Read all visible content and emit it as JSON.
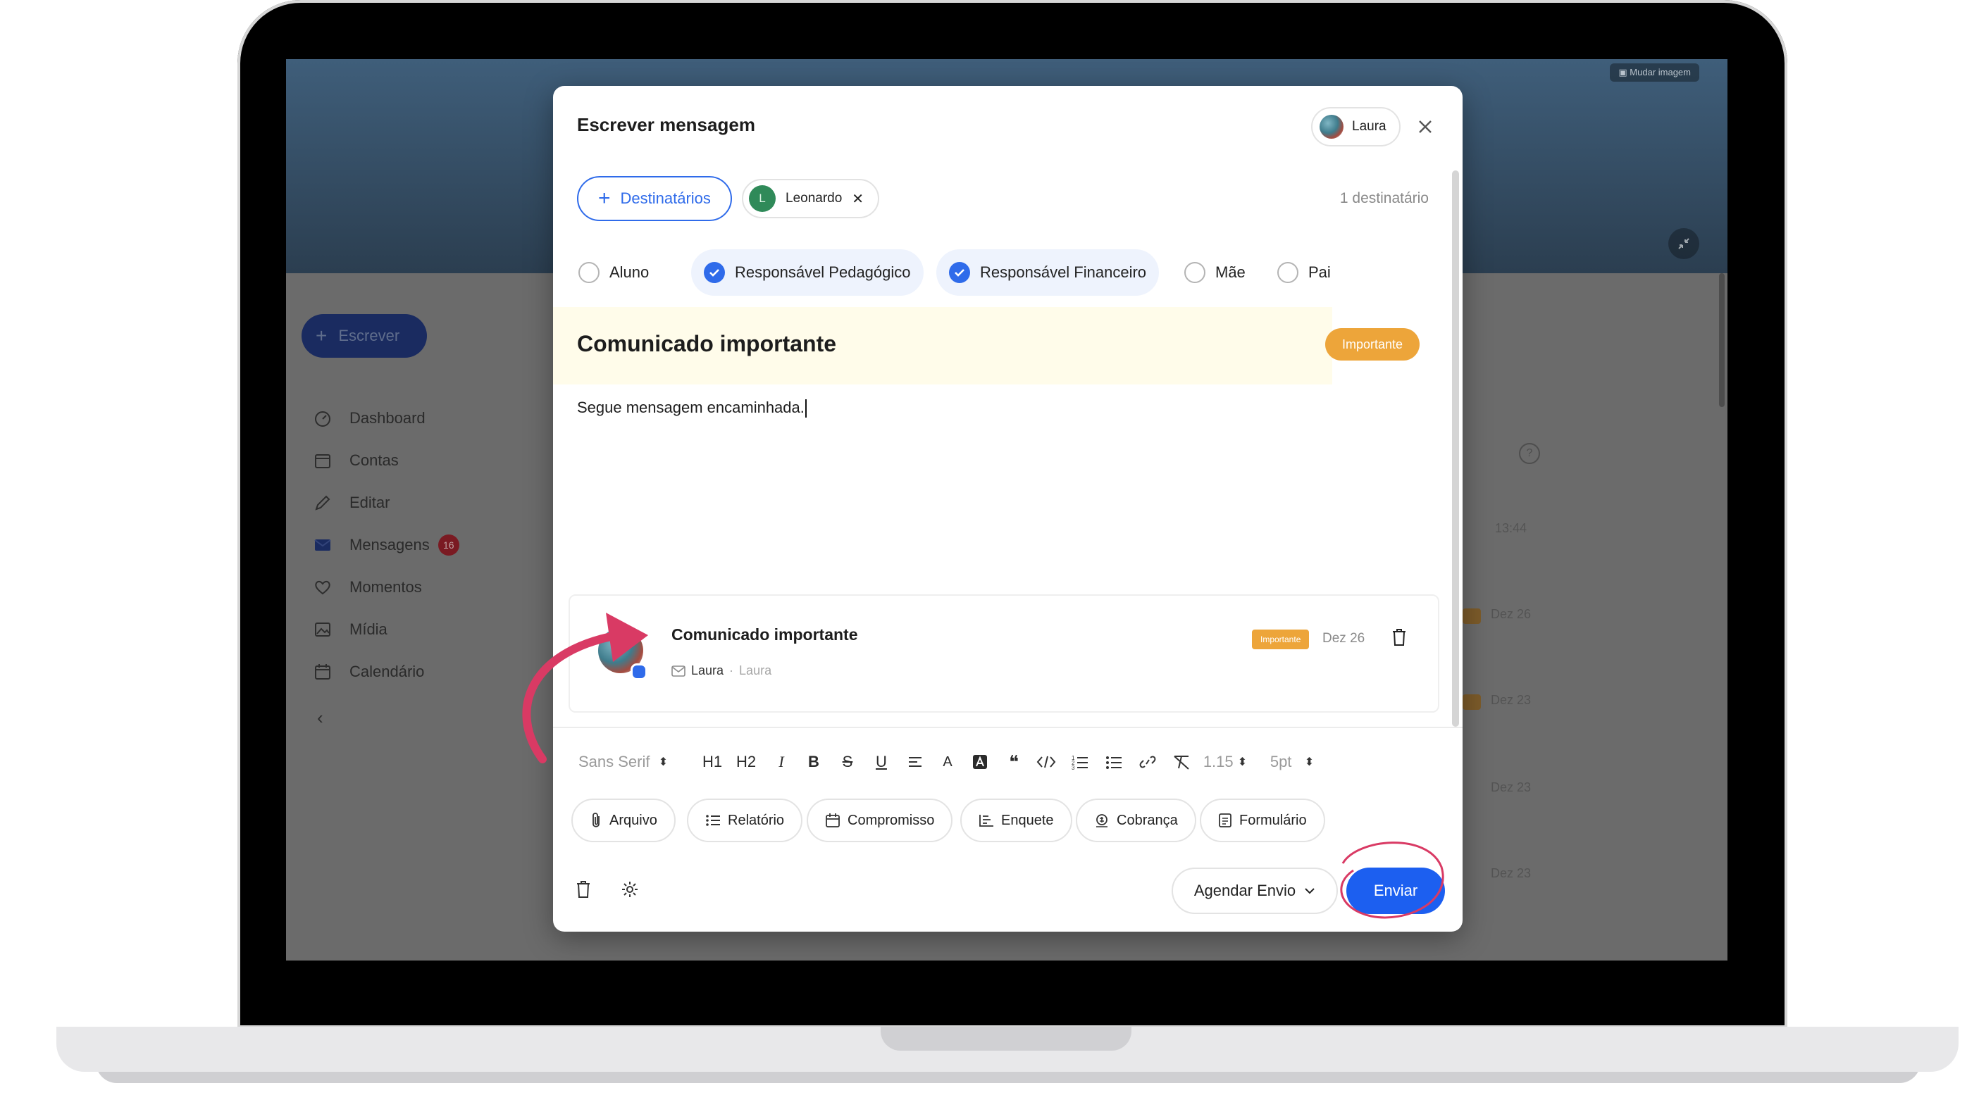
{
  "background_app": {
    "change_image_label": "Mudar imagem",
    "compose_label": "Escrever",
    "nav": [
      {
        "label": "Dashboard",
        "icon": "dashboard-icon"
      },
      {
        "label": "Contas",
        "icon": "calendar-icon"
      },
      {
        "label": "Editar",
        "icon": "pencil-icon"
      },
      {
        "label": "Mensagens",
        "icon": "envelope-icon",
        "badge": "16"
      },
      {
        "label": "Momentos",
        "icon": "heart-icon"
      },
      {
        "label": "Mídia",
        "icon": "image-icon"
      },
      {
        "label": "Calendário",
        "icon": "calendar-icon"
      }
    ],
    "list_times": [
      "13:44",
      "Dez 26",
      "Dez 23",
      "Dez 23",
      "Dez 23"
    ]
  },
  "modal": {
    "title": "Escrever mensagem",
    "sender_name": "Laura",
    "recipients_button_label": "Destinatários",
    "recipient_chip": {
      "initial": "L",
      "name": "Leonardo"
    },
    "recipient_count": "1 destinatário",
    "roles": [
      {
        "label": "Aluno",
        "checked": false
      },
      {
        "label": "Responsável Pedagógico",
        "checked": true
      },
      {
        "label": "Responsável Financeiro",
        "checked": true
      },
      {
        "label": "Mãe",
        "checked": false
      },
      {
        "label": "Pai",
        "checked": false
      }
    ],
    "subject": "Comunicado importante",
    "importance_label": "Importante",
    "body": "Segue mensagem encaminhada.",
    "quoted_message": {
      "title": "Comunicado importante",
      "badge": "Importante",
      "date": "Dez 26",
      "sender": "Laura",
      "sender_secondary": "Laura"
    },
    "toolbar": {
      "font": "Sans Serif",
      "h1": "H1",
      "h2": "H2",
      "italic": "I",
      "bold": "B",
      "strike": "S",
      "underline": "U",
      "text_color": "A",
      "line_height": "1.15",
      "font_size": "5pt"
    },
    "attachments": [
      {
        "label": "Arquivo",
        "icon": "paperclip-icon"
      },
      {
        "label": "Relatório",
        "icon": "list-icon"
      },
      {
        "label": "Compromisso",
        "icon": "calendar-icon"
      },
      {
        "label": "Enquete",
        "icon": "poll-icon"
      },
      {
        "label": "Cobrança",
        "icon": "money-icon"
      },
      {
        "label": "Formulário",
        "icon": "form-icon"
      }
    ],
    "schedule_label": "Agendar Envio",
    "send_label": "Enviar"
  },
  "colors": {
    "accent": "#1c5ff0",
    "important": "#eda53a",
    "annotation": "#d93a64"
  }
}
